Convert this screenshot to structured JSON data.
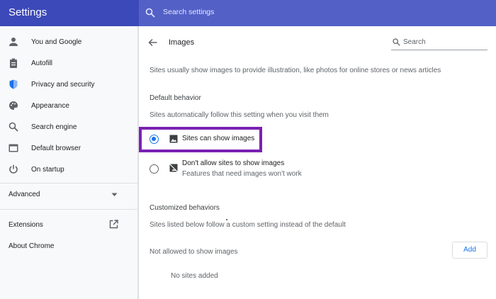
{
  "app": {
    "title": "Settings"
  },
  "search": {
    "placeholder": "Search settings"
  },
  "sidebar": {
    "items": [
      {
        "label": "You and Google",
        "icon": "person-icon"
      },
      {
        "label": "Autofill",
        "icon": "clipboard-icon"
      },
      {
        "label": "Privacy and security",
        "icon": "shield-icon"
      },
      {
        "label": "Appearance",
        "icon": "palette-icon"
      },
      {
        "label": "Search engine",
        "icon": "search-icon"
      },
      {
        "label": "Default browser",
        "icon": "browser-icon"
      },
      {
        "label": "On startup",
        "icon": "power-icon"
      }
    ],
    "advanced_label": "Advanced",
    "extensions_label": "Extensions",
    "about_label": "About Chrome"
  },
  "content": {
    "title": "Images",
    "search_placeholder": "Search",
    "description": "Sites usually show images to provide illustration, like photos for online stores or news articles",
    "default_behavior": {
      "heading": "Default behavior",
      "subtext": "Sites automatically follow this setting when you visit them",
      "options": [
        {
          "label": "Sites can show images",
          "selected": true
        },
        {
          "label": "Don't allow sites to show images",
          "sublabel": "Features that need images won't work",
          "selected": false
        }
      ]
    },
    "customized": {
      "heading": "Customized behaviors",
      "subtext": "Sites listed below follow a custom setting instead of the default",
      "not_allowed_label": "Not allowed to show images",
      "add_label": "Add",
      "empty_label": "No sites added"
    }
  },
  "colors": {
    "header": "#3c49b8",
    "header_search": "#5361c7",
    "accent": "#1a73e8",
    "highlight": "#7a21b3"
  }
}
